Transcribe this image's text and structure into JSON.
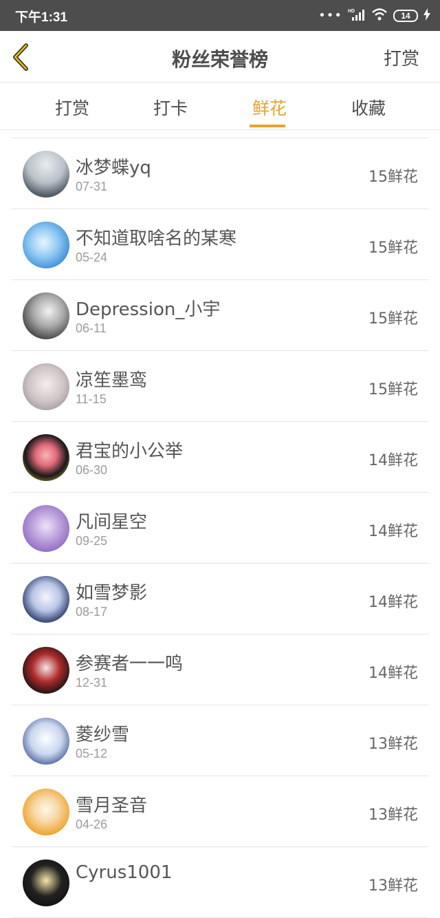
{
  "status_bar": {
    "time": "下午1:31",
    "battery": "14",
    "icons": [
      "more-dots-icon",
      "signal-hd-icon",
      "wifi-icon",
      "battery-icon",
      "charging-icon"
    ]
  },
  "header": {
    "title": "粉丝荣誉榜",
    "action_label": "打赏",
    "back_icon": "back-chevron-icon"
  },
  "tabs": [
    {
      "label": "打赏",
      "active": false
    },
    {
      "label": "打卡",
      "active": false
    },
    {
      "label": "鲜花",
      "active": true
    },
    {
      "label": "收藏",
      "active": false
    }
  ],
  "colors": {
    "accent": "#f0a02a",
    "status_bar": "#4d4d4d",
    "text": "#4d4d4d",
    "subtext": "#9b9b9b"
  },
  "fans": [
    {
      "name": "冰梦蝶yq",
      "date": "07-31",
      "count": "15鲜花"
    },
    {
      "name": "不知道取啥名的某寒",
      "date": "05-24",
      "count": "15鲜花"
    },
    {
      "name": "Depression_小宇",
      "date": "06-11",
      "count": "15鲜花"
    },
    {
      "name": "凉笙墨鸾",
      "date": "11-15",
      "count": "15鲜花"
    },
    {
      "name": "君宝的小公举",
      "date": "06-30",
      "count": "14鲜花"
    },
    {
      "name": "凡间星空",
      "date": "09-25",
      "count": "14鲜花"
    },
    {
      "name": "如雪梦影",
      "date": "08-17",
      "count": "14鲜花"
    },
    {
      "name": "参赛者一一鸣",
      "date": "12-31",
      "count": "14鲜花"
    },
    {
      "name": "菱纱雪",
      "date": "05-12",
      "count": "13鲜花"
    },
    {
      "name": "雪月圣音",
      "date": "04-26",
      "count": "13鲜花"
    },
    {
      "name": "Cyrus1001",
      "date": "",
      "count": "13鲜花"
    }
  ]
}
